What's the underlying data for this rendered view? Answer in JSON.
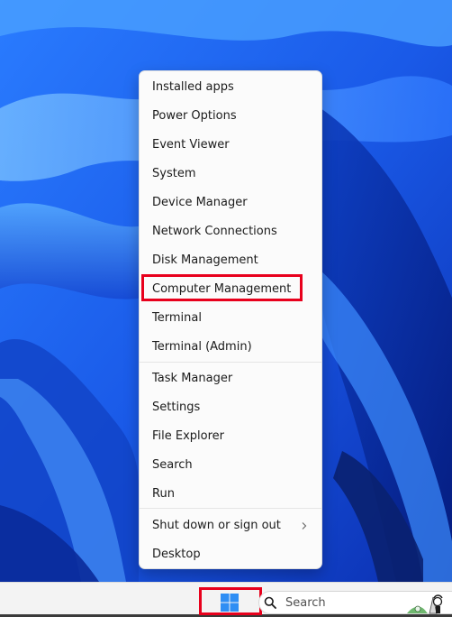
{
  "context_menu": {
    "items": [
      {
        "label": "Installed apps"
      },
      {
        "label": "Power Options"
      },
      {
        "label": "Event Viewer"
      },
      {
        "label": "System"
      },
      {
        "label": "Device Manager"
      },
      {
        "label": "Network Connections"
      },
      {
        "label": "Disk Management"
      },
      {
        "label": "Computer Management"
      },
      {
        "label": "Terminal"
      },
      {
        "label": "Terminal (Admin)"
      },
      {
        "label": "Task Manager"
      },
      {
        "label": "Settings"
      },
      {
        "label": "File Explorer"
      },
      {
        "label": "Search"
      },
      {
        "label": "Run"
      },
      {
        "label": "Shut down or sign out",
        "has_submenu": true
      },
      {
        "label": "Desktop"
      }
    ],
    "highlighted_item": "Computer Management"
  },
  "taskbar": {
    "start_icon": "windows-logo-icon",
    "search_label": "Search",
    "search_icon": "search-icon",
    "highlighted_element": "start-button"
  },
  "colors": {
    "highlight": "#e8001c",
    "wallpaper_blue": "#1d63f0",
    "start_blue": "#2f8ef4"
  }
}
